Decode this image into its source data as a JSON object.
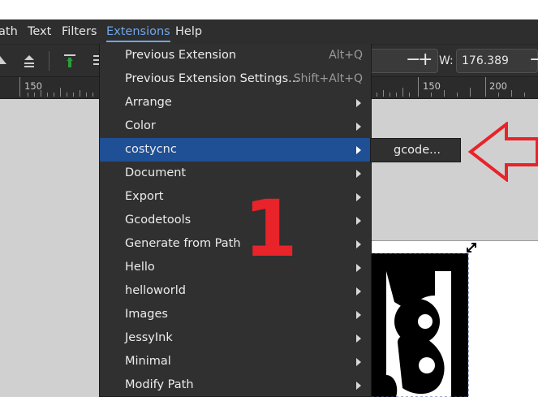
{
  "menubar": {
    "items": [
      "ath",
      "Text",
      "Filters",
      "Extensions",
      "Help"
    ],
    "active_index": 3
  },
  "toolbar": {
    "w_label": "W:",
    "w_value": "176.389",
    "minus": "−",
    "plus": "+"
  },
  "ruler": {
    "labels": [
      "150",
      "150",
      "200"
    ]
  },
  "extensions_menu": {
    "items": [
      {
        "label": "Previous Extension",
        "shortcut": "Alt+Q",
        "submenu": false
      },
      {
        "label": "Previous Extension Settings...",
        "shortcut": "Shift+Alt+Q",
        "submenu": false
      },
      {
        "label": "Arrange",
        "shortcut": "",
        "submenu": true
      },
      {
        "label": "Color",
        "shortcut": "",
        "submenu": true
      },
      {
        "label": "costycnc",
        "shortcut": "",
        "submenu": true,
        "highlighted": true
      },
      {
        "label": "Document",
        "shortcut": "",
        "submenu": true
      },
      {
        "label": "Export",
        "shortcut": "",
        "submenu": true
      },
      {
        "label": "Gcodetools",
        "shortcut": "",
        "submenu": true
      },
      {
        "label": "Generate from Path",
        "shortcut": "",
        "submenu": true
      },
      {
        "label": "Hello",
        "shortcut": "",
        "submenu": true
      },
      {
        "label": "helloworld",
        "shortcut": "",
        "submenu": true
      },
      {
        "label": "Images",
        "shortcut": "",
        "submenu": true
      },
      {
        "label": "JessyInk",
        "shortcut": "",
        "submenu": true
      },
      {
        "label": "Minimal",
        "shortcut": "",
        "submenu": true
      },
      {
        "label": "Modify Path",
        "shortcut": "",
        "submenu": true
      }
    ]
  },
  "submenu": {
    "items": [
      {
        "label": "gcode..."
      }
    ]
  },
  "annotation": {
    "number": "1",
    "color": "#e8232a"
  },
  "colors": {
    "highlight": "#1f4f95",
    "menu_bg": "#303030",
    "active_menu_text": "#6ea6ea"
  }
}
